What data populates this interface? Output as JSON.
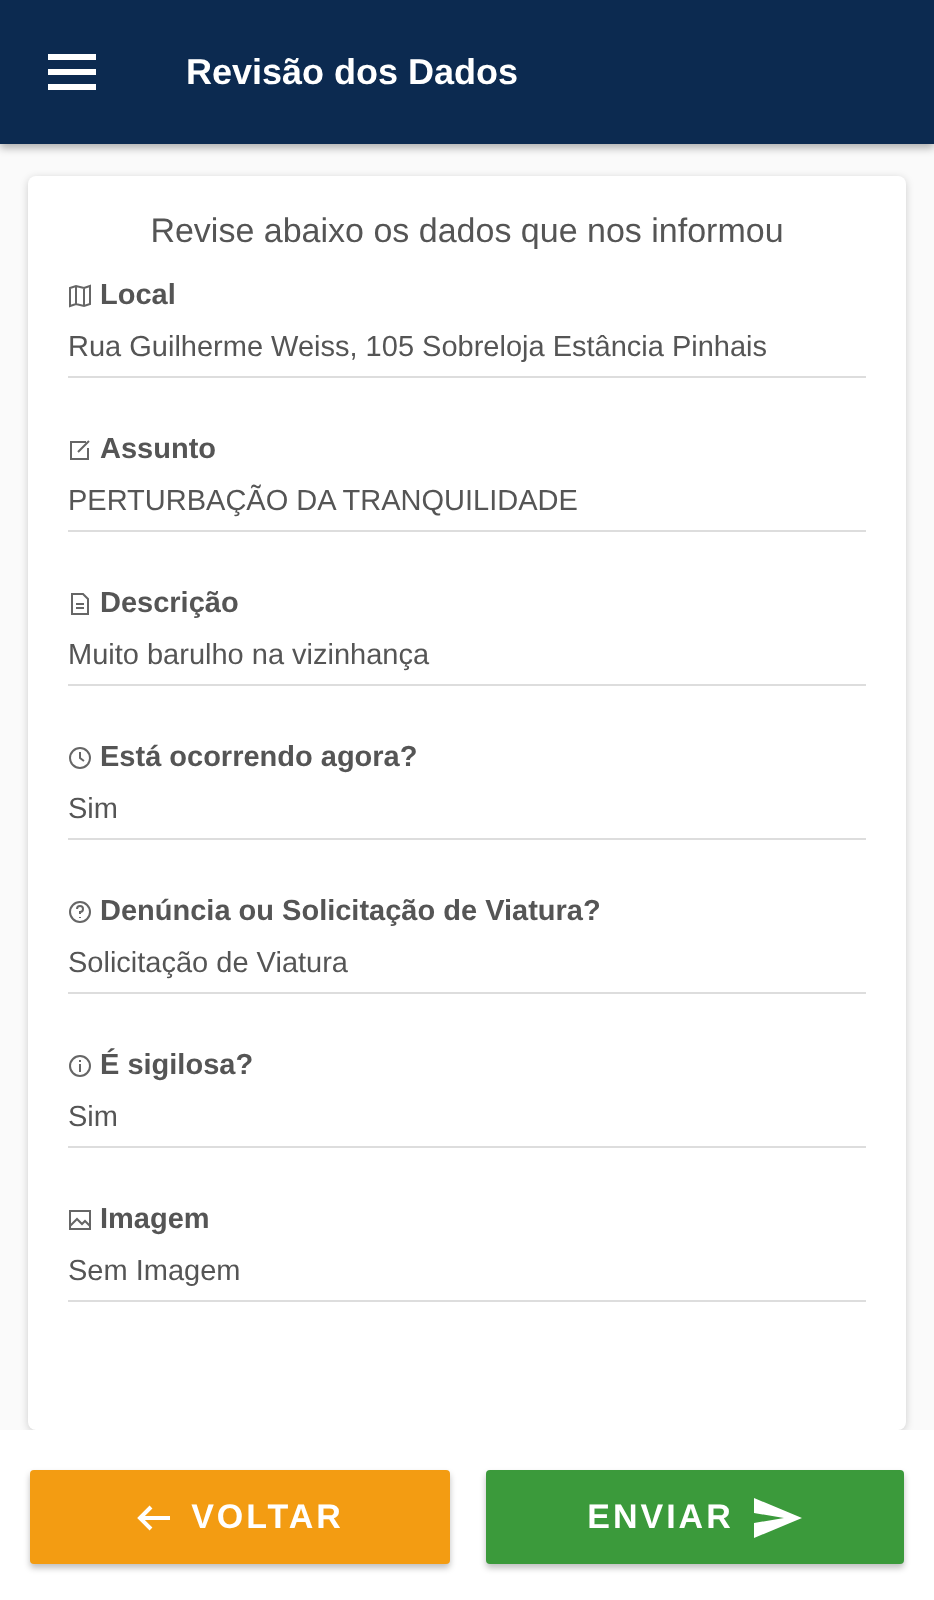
{
  "header": {
    "title": "Revisão dos Dados"
  },
  "card": {
    "heading": "Revise abaixo os dados que nos informou",
    "fields": [
      {
        "label": "Local",
        "value": "Rua Guilherme Weiss, 105 Sobreloja Estância Pinhais"
      },
      {
        "label": "Assunto",
        "value": "PERTURBAÇÃO DA TRANQUILIDADE"
      },
      {
        "label": "Descrição",
        "value": "Muito barulho na vizinhança"
      },
      {
        "label": "Está ocorrendo agora?",
        "value": "Sim"
      },
      {
        "label": "Denúncia ou Solicitação de Viatura?",
        "value": "Solicitação de Viatura"
      },
      {
        "label": "É sigilosa?",
        "value": "Sim"
      },
      {
        "label": "Imagem",
        "value": "Sem Imagem"
      }
    ]
  },
  "buttons": [
    {
      "kind": "back",
      "label": "VOLTAR"
    },
    {
      "kind": "send",
      "label": "ENVIAR"
    }
  ]
}
